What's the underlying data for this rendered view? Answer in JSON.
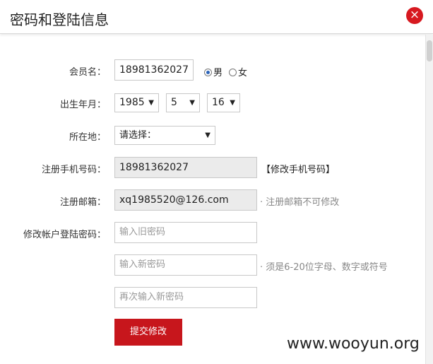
{
  "header": {
    "title": "密码和登陆信息",
    "close_icon": "close-icon",
    "close_glyph": "×"
  },
  "form": {
    "member_label": "会员名：",
    "member_value": "18981362027",
    "gender": {
      "options": [
        {
          "label": "男",
          "checked": true
        },
        {
          "label": "女",
          "checked": false
        }
      ]
    },
    "birth_label": "出生年月：",
    "birth_year": "1985",
    "birth_month": "5",
    "birth_day": "16",
    "location_label": "所在地：",
    "location_value": "请选择：",
    "phone_label": "注册手机号码：",
    "phone_value": "18981362027",
    "phone_link": "【修改手机号码】",
    "email_label": "注册邮箱：",
    "email_value": "xq1985520@126.com",
    "email_hint": "· 注册邮箱不可修改",
    "password_label": "修改帐户登陆密码：",
    "old_password_placeholder": "输入旧密码",
    "new_password_placeholder": "输入新密码",
    "new_password_hint": "· 须是6-20位字母、数字或符号",
    "confirm_password_placeholder": "再次输入新密码",
    "submit_label": "提交修改"
  },
  "watermark": "www.wooyun.org",
  "colors": {
    "accent": "#c7161c",
    "close": "#d71920"
  }
}
